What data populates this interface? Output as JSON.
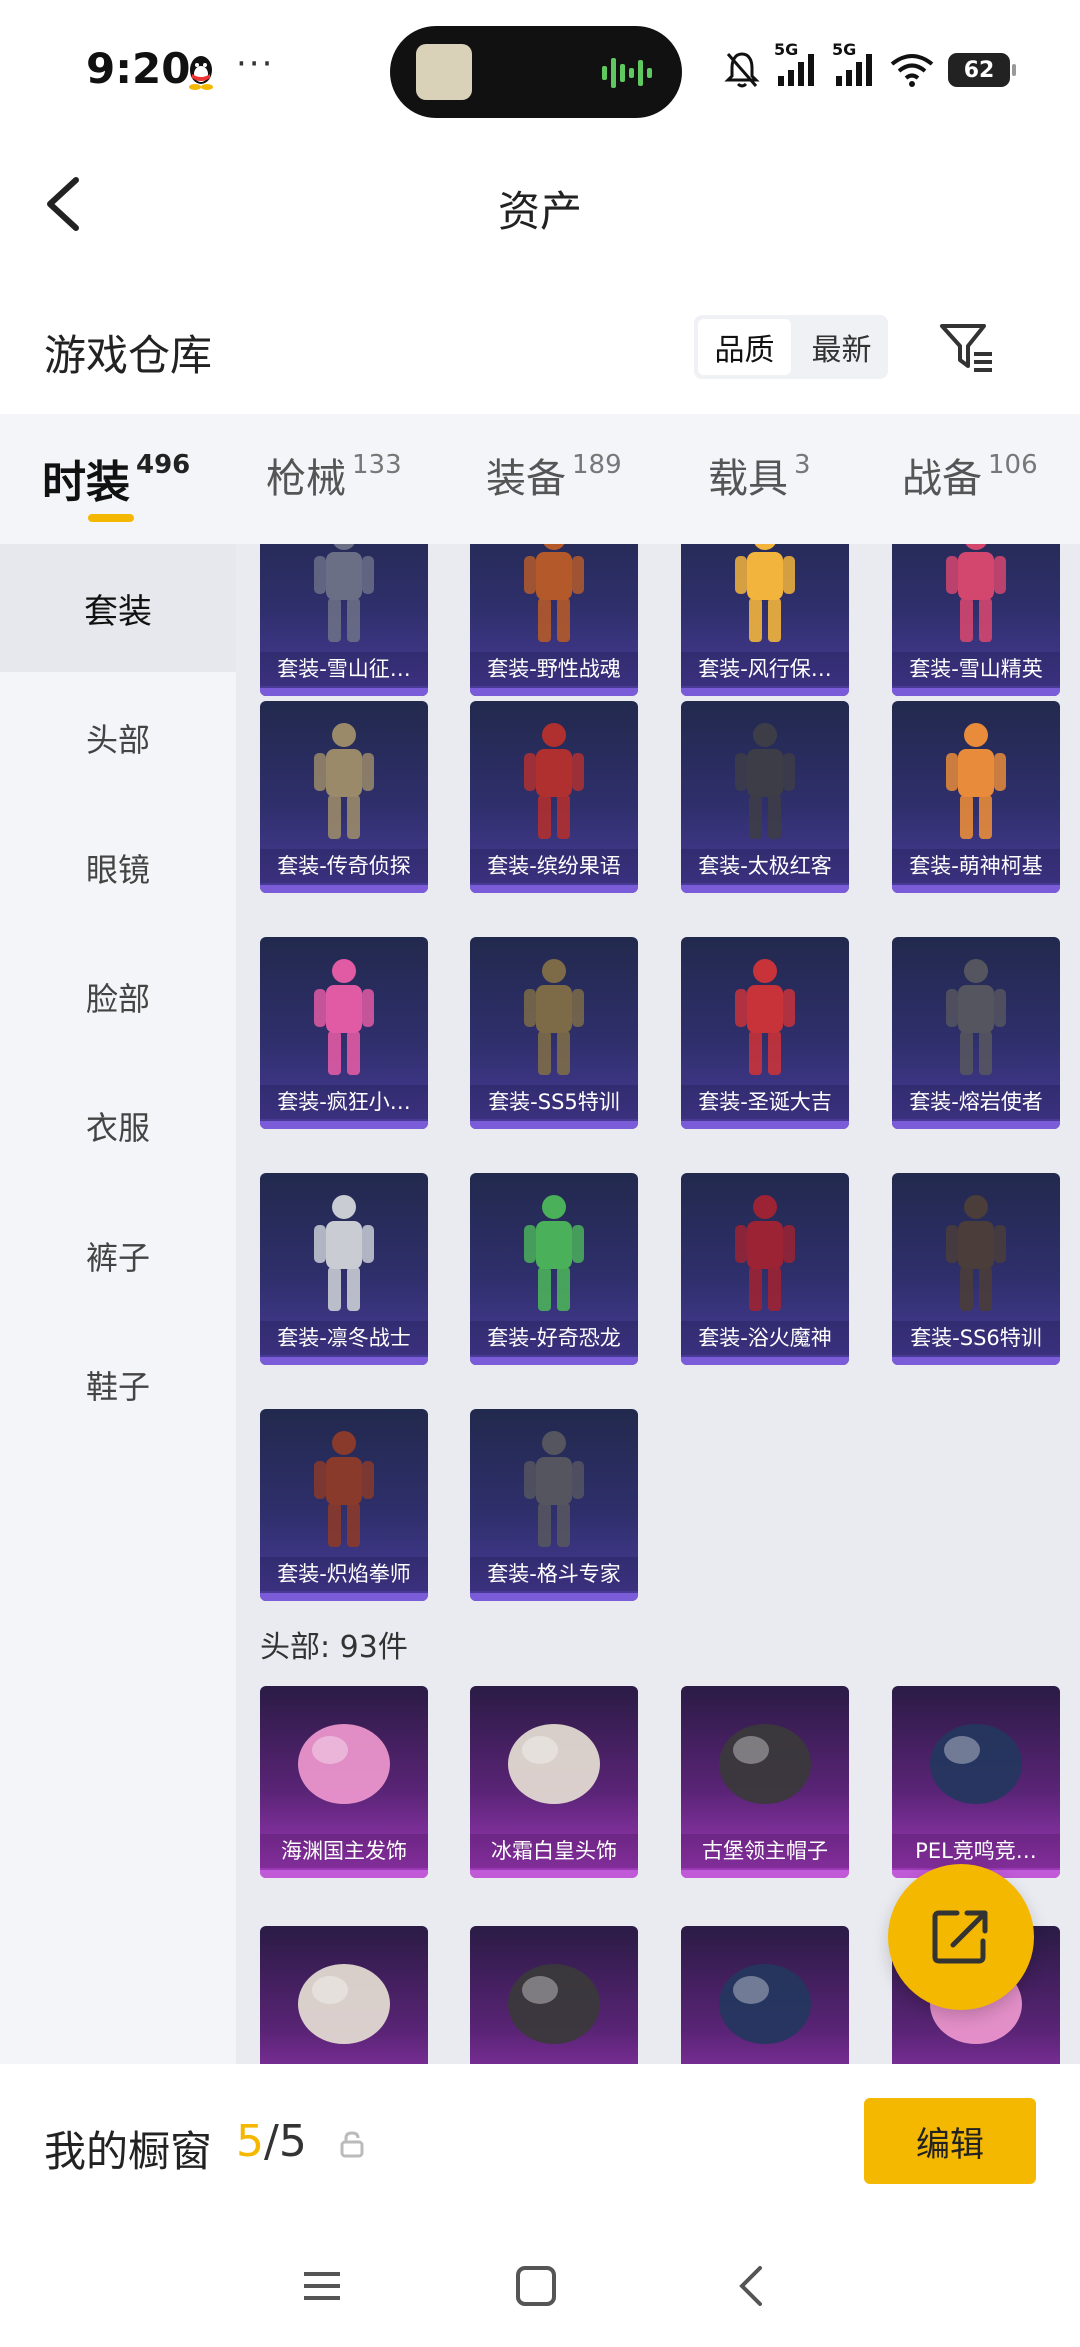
{
  "status": {
    "time": "9:20",
    "dots": "···",
    "battery": "62",
    "net1": "5G",
    "net2": "5G"
  },
  "nav": {
    "title": "资产"
  },
  "warehouse": {
    "title": "游戏仓库",
    "sort_options": [
      "品质",
      "最新"
    ],
    "active_sort": "品质"
  },
  "tabs": [
    {
      "label": "时装",
      "count": "496"
    },
    {
      "label": "枪械",
      "count": "133"
    },
    {
      "label": "装备",
      "count": "189"
    },
    {
      "label": "载具",
      "count": "3"
    },
    {
      "label": "战备",
      "count": "106"
    }
  ],
  "sidebar": [
    "套装",
    "头部",
    "眼镜",
    "脸部",
    "衣服",
    "裤子",
    "鞋子"
  ],
  "suits": [
    "套装-雪山征…",
    "套装-野性战魂",
    "套装-风行保…",
    "套装-雪山精英",
    "套装-传奇侦探",
    "套装-缤纷果语",
    "套装-太极红客",
    "套装-萌神柯基",
    "套装-疯狂小…",
    "套装-SS5特训",
    "套装-圣诞大吉",
    "套装-熔岩使者",
    "套装-凛冬战士",
    "套装-好奇恐龙",
    "套装-浴火魔神",
    "套装-SS6特训",
    "套装-炽焰拳师",
    "套装-格斗专家"
  ],
  "head_section": {
    "title": "头部: 93件"
  },
  "heads": [
    "海渊国主发饰",
    "冰霜白皇头饰",
    "古堡领主帽子",
    "PEL竞鸣竞…"
  ],
  "showcase": {
    "title": "我的橱窗",
    "used": "5",
    "total": "/5",
    "edit": "编辑"
  }
}
